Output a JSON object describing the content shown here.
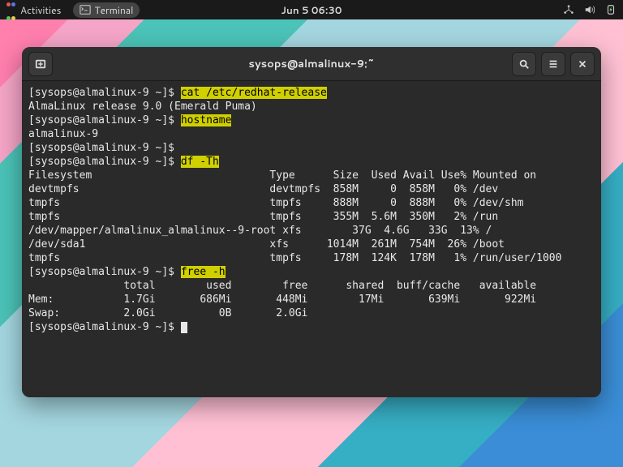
{
  "topbar": {
    "activities": "Activities",
    "app_label": "Terminal",
    "clock": "Jun 5  06:30"
  },
  "window": {
    "title": "sysops@almalinux-9:~"
  },
  "term": {
    "prompt": "[sysops@almalinux-9 ~]$",
    "cmd1": "cat /etc/redhat-release",
    "out1": "AlmaLinux release 9.0 (Emerald Puma)",
    "cmd2": "hostname",
    "out2": "almalinux-9",
    "cmd4": "df -Th",
    "df_header": "Filesystem                            Type      Size  Used Avail Use% Mounted on",
    "df_rows": [
      "devtmpfs                              devtmpfs  858M     0  858M   0% /dev",
      "tmpfs                                 tmpfs     888M     0  888M   0% /dev/shm",
      "tmpfs                                 tmpfs     355M  5.6M  350M   2% /run",
      "/dev/mapper/almalinux_almalinux--9-root xfs        37G  4.6G   33G  13% /",
      "/dev/sda1                             xfs      1014M  261M  754M  26% /boot",
      "tmpfs                                 tmpfs     178M  124K  178M   1% /run/user/1000"
    ],
    "cmd5": "free -h",
    "free_header": "               total        used        free      shared  buff/cache   available",
    "free_rows": [
      "Mem:           1.7Gi       686Mi       448Mi        17Mi       639Mi       922Mi",
      "Swap:          2.0Gi          0B       2.0Gi"
    ]
  }
}
